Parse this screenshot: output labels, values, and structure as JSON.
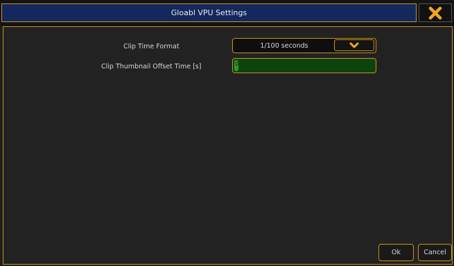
{
  "dialog": {
    "title": "Gloabl VPU Settings",
    "close_icon": "close-x-icon"
  },
  "settings": {
    "clip_time_format": {
      "label": "Clip Time Format",
      "value": "1/100 seconds",
      "arrow_icon": "chevron-down-icon"
    },
    "clip_thumbnail_offset": {
      "label": "Clip Thumbnail Offset Time [s]",
      "value": "0"
    }
  },
  "footer": {
    "ok_label": "Ok",
    "cancel_label": "Cancel"
  },
  "colors": {
    "accent": "#c8941e",
    "title_bg": "#14285e",
    "input_bg": "#0c430c"
  }
}
